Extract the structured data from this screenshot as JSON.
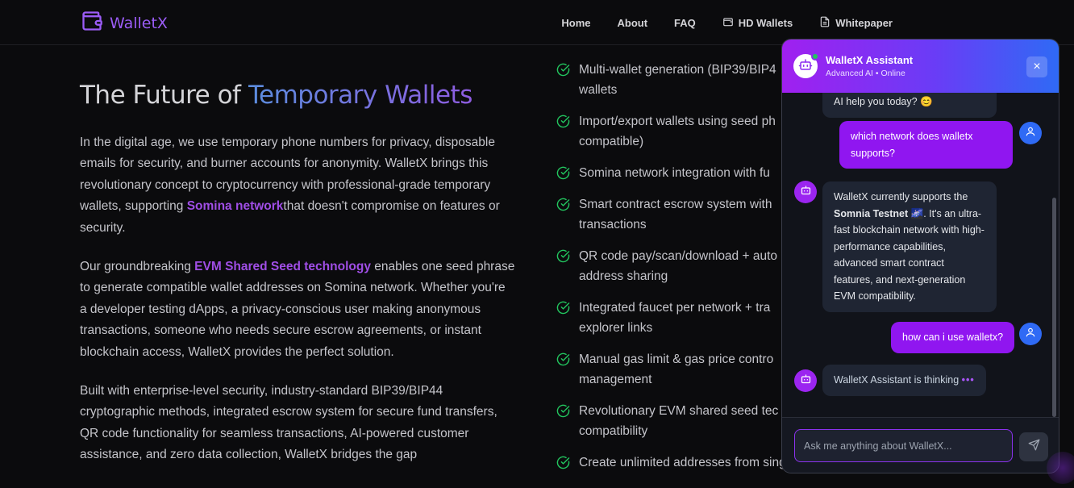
{
  "brand": {
    "name": "WalletX",
    "color": "#9b5cf6"
  },
  "nav": [
    {
      "label": "Home",
      "icon": ""
    },
    {
      "label": "About",
      "icon": ""
    },
    {
      "label": "FAQ",
      "icon": ""
    },
    {
      "label": "HD Wallets",
      "icon": "wallet-icon"
    },
    {
      "label": "Whitepaper",
      "icon": "document-icon"
    }
  ],
  "hero": {
    "title_plain": "The Future of ",
    "title_highlight": "Temporary Wallets",
    "p1_a": "In the digital age, we use temporary phone numbers for privacy, disposable emails for security, and burner accounts for anonymity. WalletX brings this revolutionary concept to cryptocurrency with professional-grade temporary wallets, supporting ",
    "p1_hl": "Somina network",
    "p1_b": "that doesn't compromise on features or security.",
    "p2_a": "Our groundbreaking ",
    "p2_hl": "EVM Shared Seed technology",
    "p2_b": " enables one seed phrase to generate compatible wallet addresses on Somina network. Whether you're a developer testing dApps, a privacy-conscious user making anonymous transactions, someone who needs secure escrow agreements, or instant blockchain access, WalletX provides the perfect solution.",
    "p3": "Built with enterprise-level security, industry-standard BIP39/BIP44 cryptographic methods, integrated escrow system for secure fund transfers, QR code functionality for seamless transactions, AI-powered customer assistance, and zero data collection, WalletX bridges the gap"
  },
  "features": [
    "Multi-wallet generation (BIP39/BIP4 wallets",
    "Import/export wallets using seed ph compatible)",
    "Somina network integration with fu",
    "Smart contract escrow system with transactions",
    "QR code pay/scan/download + auto address sharing",
    "Integrated faucet per network + tra explorer links",
    "Manual gas limit & gas price contro management",
    "Revolutionary EVM shared seed tec compatibility",
    "Create unlimited addresses from sing"
  ],
  "chat": {
    "title": "WalletX Assistant",
    "subtitle": "Advanced AI • Online",
    "close_label": "×",
    "messages": {
      "m0": "AI help you today? 😊",
      "m1": "which network does walletx supports?",
      "m2_a": "WalletX currently supports the ",
      "m2_bold": "Somnia Testnet",
      "m2_emoji": " 🌌",
      "m2_b": ". It's an ultra-fast blockchain network with high-performance capabilities, advanced smart contract features, and next-generation EVM compatibility.",
      "m3": "how can i use walletx?",
      "m4": "WalletX Assistant is thinking",
      "m4_dots": "•••"
    },
    "input_placeholder": "Ask me anything about WalletX..."
  },
  "colors": {
    "accent": "#9016f0",
    "check": "#22c55e",
    "user_avatar": "#2f6af5"
  }
}
